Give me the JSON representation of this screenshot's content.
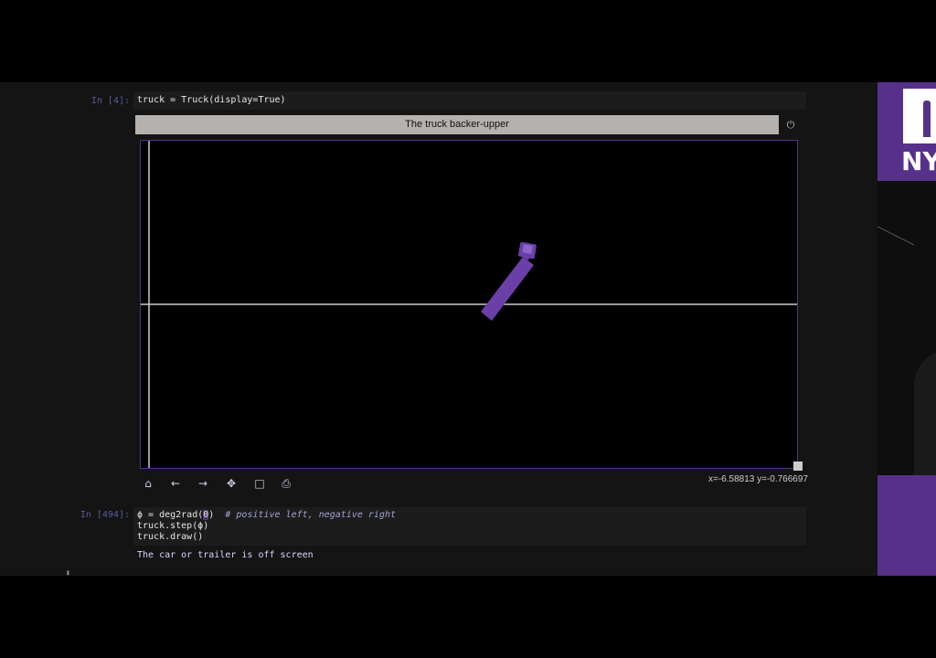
{
  "cells": [
    {
      "prompt": "In [4]:",
      "code": "truck = Truck(display=True)"
    },
    {
      "prompt": "In [494]:",
      "line1_a": "ϕ = deg2rad(",
      "line1_b": "0",
      "line1_c": ")",
      "line1_comment": "# positive left, negative right",
      "line2": "truck.step(ϕ)",
      "line3": "truck.draw()",
      "output": "The car or trailer is off screen"
    }
  ],
  "figure": {
    "title": "The truck backer-upper",
    "power_icon": "⏻",
    "coords": "x=-6.58813 y=-0.766697"
  },
  "toolbar": {
    "home": "⌂",
    "back": "←",
    "forward": "→",
    "pan": "✥",
    "zoom": "□",
    "save": "⎙"
  },
  "branding": {
    "logo_text": "NYU"
  },
  "colors": {
    "accent": "#57308a",
    "truck": "#6b3fa8",
    "background": "#000000"
  }
}
